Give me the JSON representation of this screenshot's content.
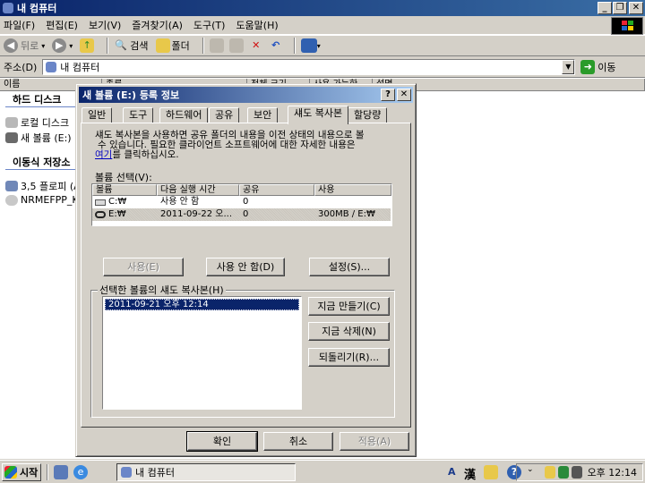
{
  "window": {
    "title": "내 컴퓨터",
    "btn_min": "_",
    "btn_max": "❐",
    "btn_close": "✕"
  },
  "menu": [
    "파일(F)",
    "편집(E)",
    "보기(V)",
    "즐겨찾기(A)",
    "도구(T)",
    "도움말(H)"
  ],
  "toolbar": {
    "back": "뒤로",
    "search": "검색",
    "folders": "폴더"
  },
  "address": {
    "label": "주소(D)",
    "value": "내 컴퓨터",
    "go": "이동"
  },
  "list": {
    "columns": [
      "이름",
      "종류",
      "전체 크기",
      "사용 가능한",
      "설명"
    ],
    "group_hdd": "하드 디스크",
    "items_hdd": [
      "로컬 디스크",
      "새 볼륨 (E:)"
    ],
    "group_removable": "이동식 저장소",
    "items_removable": [
      "3,5 플로피 (A",
      "NRMEFPP_K"
    ]
  },
  "dialog": {
    "title": "새 볼륨 (E:) 등록 정보",
    "help_btn": "?",
    "close_btn": "✕",
    "tabs": [
      "일반",
      "도구",
      "하드웨어",
      "공유",
      "보안",
      "섀도 복사본",
      "할당량"
    ],
    "description_1": "섀도 복사본을 사용하면 공유 폴더의 내용을 이전 상태의 내용으로 볼",
    "description_2": "수 있습니다. 필요한 클라이언트 소프트웨어에 대한 자세한 내용은",
    "description_link": "여기",
    "description_3": "를 클릭하십시오.",
    "select_label": "볼륨 선택(V):",
    "columns": [
      "볼륨",
      "다음 실행 시간",
      "공유",
      "사용"
    ],
    "volumes": [
      {
        "name": "C:₩",
        "next": "사용 안 함",
        "shares": "0",
        "used": ""
      },
      {
        "name": "E:₩",
        "next": "2011-09-22 오...",
        "shares": "0",
        "used": "300MB / E:₩"
      }
    ],
    "btn_enable": "사용(E)",
    "btn_disable": "사용 안 함(D)",
    "btn_settings": "설정(S)...",
    "group_label": "선택한 볼륨의 섀도 복사본(H)",
    "snapshot": "2011-09-21 오후 12:14",
    "btn_create": "지금 만들기(C)",
    "btn_delete": "지금 삭제(N)",
    "btn_revert": "되돌리기(R)...",
    "btn_ok": "확인",
    "btn_cancel": "취소",
    "btn_apply": "적용(A)"
  },
  "taskbar": {
    "start": "시작",
    "task": "내 컴퓨터",
    "ime_a": "A",
    "ime_han": "漢",
    "clock": "오후 12:14"
  }
}
